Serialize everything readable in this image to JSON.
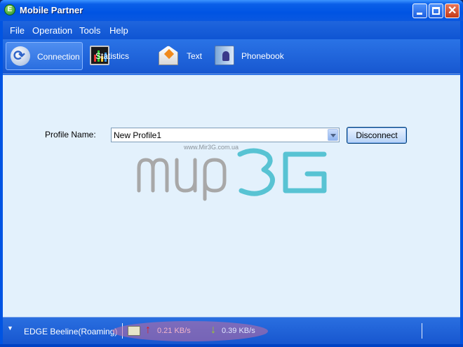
{
  "window": {
    "title": "Mobile Partner",
    "app_icon": "mobile-partner-icon"
  },
  "menu": {
    "items": [
      {
        "label": "File"
      },
      {
        "label": "Operation"
      },
      {
        "label": "Tools"
      },
      {
        "label": "Help"
      }
    ]
  },
  "toolbar": {
    "items": [
      {
        "label": "Connection",
        "icon": "connection-icon",
        "active": true
      },
      {
        "label": "Statistics",
        "icon": "statistics-icon",
        "active": false
      },
      {
        "label": "Text",
        "icon": "envelope-icon",
        "active": false
      },
      {
        "label": "Phonebook",
        "icon": "phonebook-icon",
        "active": false
      }
    ]
  },
  "connection": {
    "profile_label": "Profile Name:",
    "profile_value": "New Profile1",
    "disconnect_label": "Disconnect"
  },
  "watermark": {
    "url": "www.Mir3G.com.ua",
    "logo_text": "Mир3G"
  },
  "status": {
    "network": "EDGE Beeline(Roaming)",
    "upload_speed": "0.21 KB/s",
    "download_speed": "0.39 KB/s"
  },
  "colors": {
    "titlebar": "#0054e3",
    "content_bg": "#e3f1fc",
    "upload_arrow": "#e01a1a",
    "download_arrow": "#9ccc2a"
  }
}
